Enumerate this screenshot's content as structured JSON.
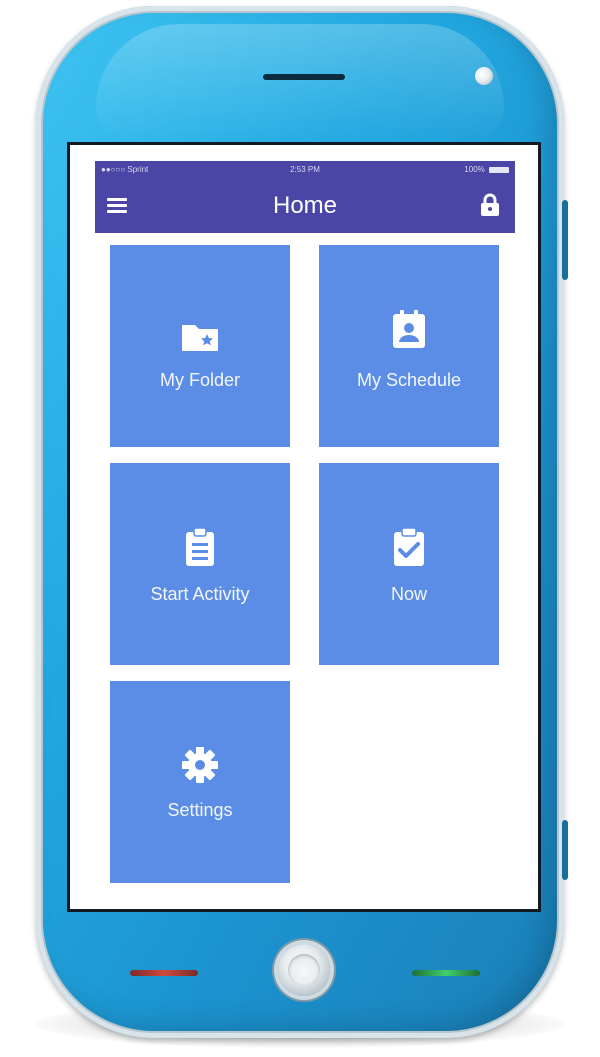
{
  "status_bar": {
    "carrier": "●●○○○ Sprint",
    "time": "2:53 PM",
    "battery": "100%"
  },
  "nav": {
    "title": "Home"
  },
  "tiles": [
    {
      "label": "My Folder",
      "icon": "folder-star-icon"
    },
    {
      "label": "My Schedule",
      "icon": "calendar-person-icon"
    },
    {
      "label": "Start Activity",
      "icon": "clipboard-list-icon"
    },
    {
      "label": "Now",
      "icon": "clipboard-check-icon"
    },
    {
      "label": "Settings",
      "icon": "gear-icon"
    }
  ],
  "colors": {
    "phone_body": "#22a9e1",
    "nav_bar": "#4b45a6",
    "tile": "#5b8de6",
    "led_left": "#d24a3c",
    "led_right": "#3fd06a"
  }
}
